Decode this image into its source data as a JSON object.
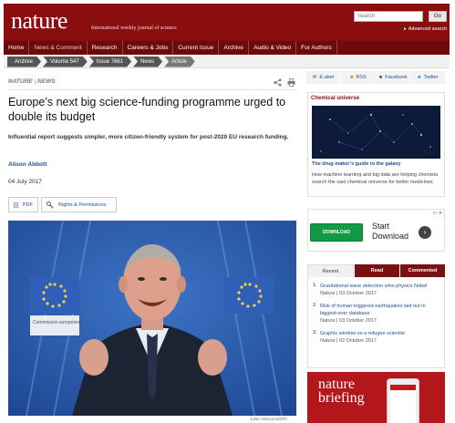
{
  "header": {
    "logo": "nature",
    "tagline": "International weekly journal of science",
    "search_placeholder": "Search",
    "go_label": "Go",
    "advanced_search": "Advanced search"
  },
  "nav": [
    "Home",
    "News & Comment",
    "Research",
    "Careers & Jobs",
    "Current Issue",
    "Archive",
    "Audio & Video",
    "For Authors"
  ],
  "breadcrumb": [
    "Archive",
    "Volume 547",
    "Issue 7661",
    "News",
    "Article"
  ],
  "article": {
    "kicker_journal": "NATURE",
    "kicker_section": "NEWS",
    "title": "Europe’s next big science-funding programme urged to double its budget",
    "standfirst": "Influential report suggests simpler, more citizen-friendly system for post-2020 EU research funding.",
    "author": "Alison Abbott",
    "date": "04 July 2017",
    "pdf_label": "PDF",
    "rights_label": "Rights & Permissions",
    "photo_credit": "Julien Warnand/EPA",
    "photo_sign_text": "Commission européenne"
  },
  "sidebar": {
    "tools": [
      "E-alert",
      "RSS",
      "Facebook",
      "Twitter"
    ],
    "chemical": {
      "title": "Chemical universe",
      "subtitle": "The drug-maker’s guide to the galaxy",
      "desc": "How machine learning and big data are helping chemists search the vast chemical universe for better medicines."
    },
    "ad": {
      "download_label": "DOWNLOAD",
      "text_line1": "Start",
      "text_line2": "Download",
      "close_label": "▷ ✕"
    },
    "tabs": [
      "Recent",
      "Read",
      "Commented"
    ],
    "list": [
      {
        "num": "1.",
        "title": "Gravitational wave detection wins physics Nobel",
        "journal": "Nature",
        "date": "| 03 October 2017"
      },
      {
        "num": "2.",
        "title": "Risk of human-triggered earthquakes laid out in biggest-ever database",
        "journal": "Nature",
        "date": "| 03 October 2017"
      },
      {
        "num": "3.",
        "title": "Graphic window on a refugee scientist",
        "journal": "Nature",
        "date": "| 02 October 2017"
      }
    ],
    "briefing": {
      "line1": "nature",
      "line2": "briefing"
    }
  }
}
